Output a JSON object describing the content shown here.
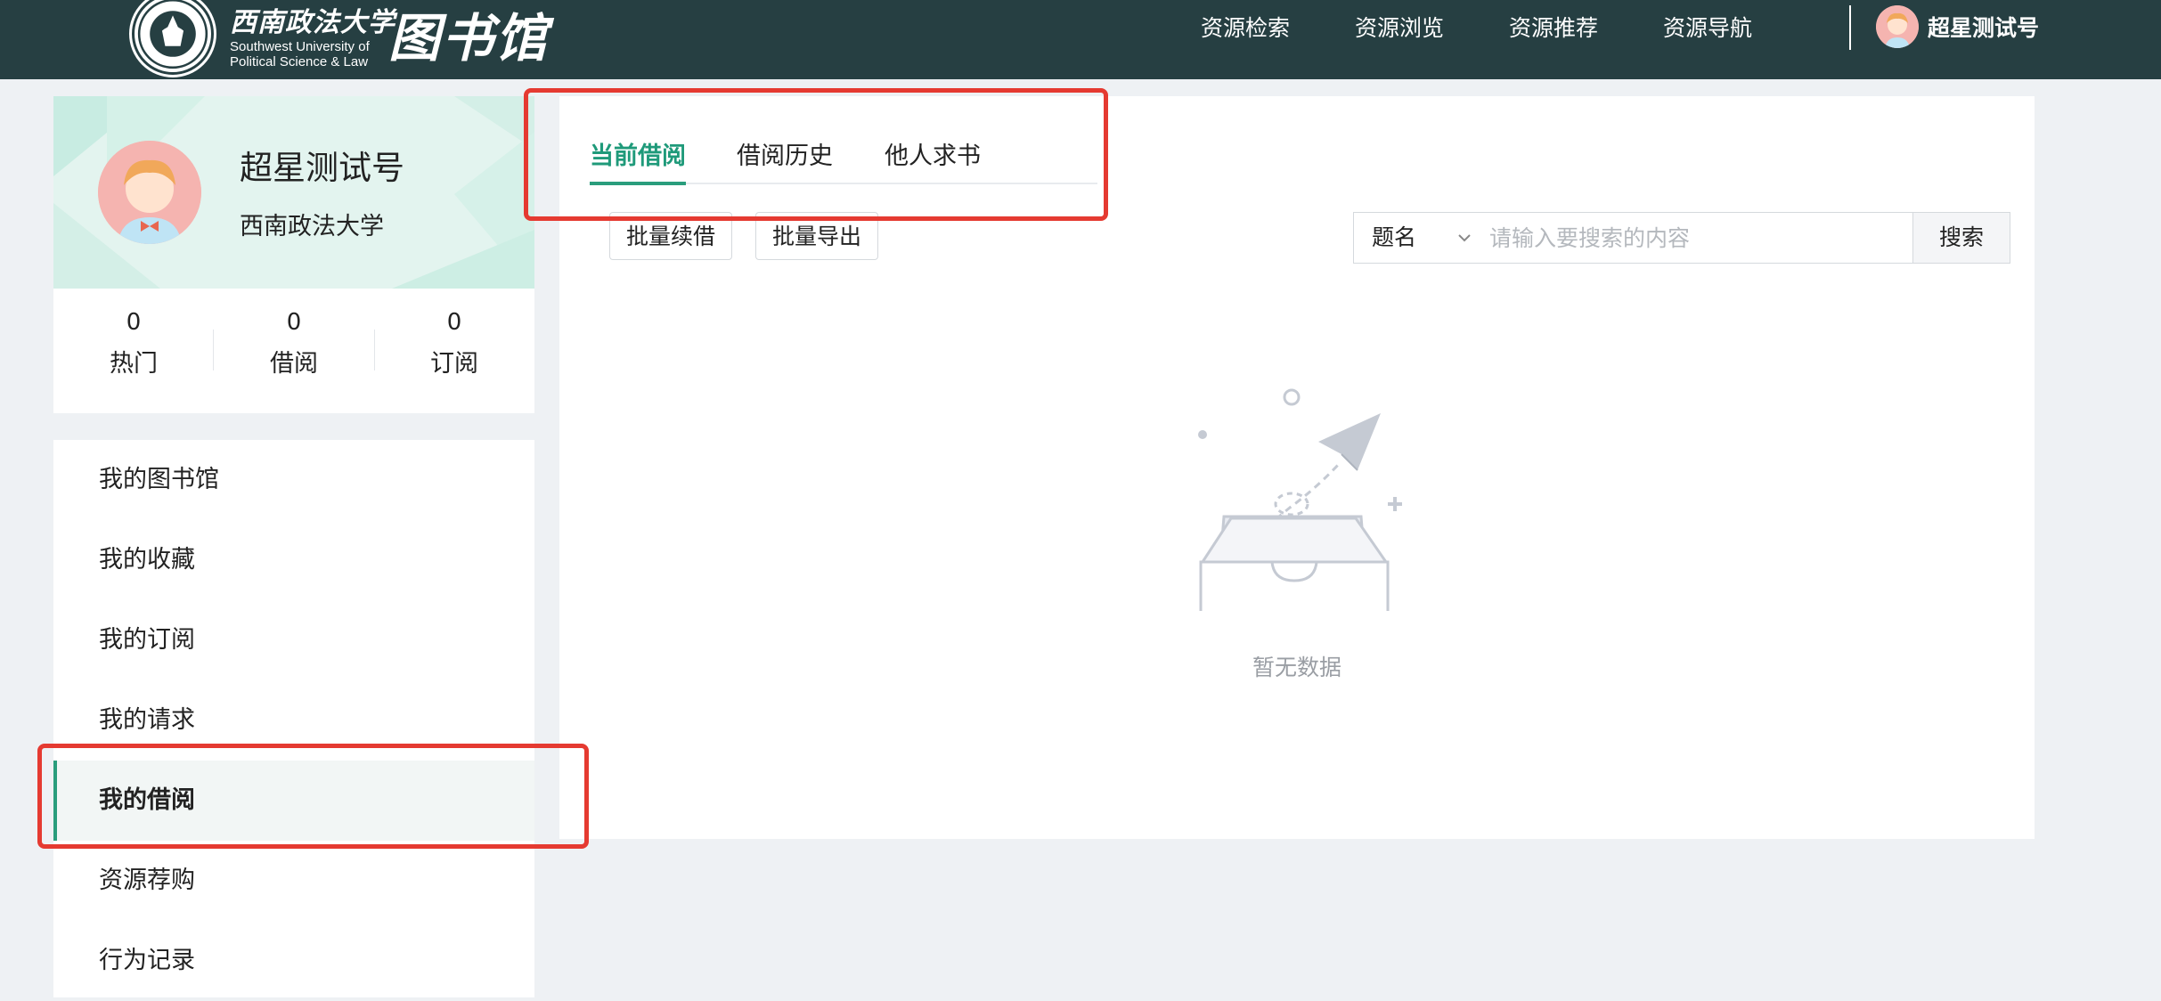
{
  "header": {
    "logo_cn": "西南政法大学",
    "logo_en_line1": "Southwest University of",
    "logo_en_line2": "Political Science & Law",
    "logo_library": "图书馆",
    "nav": [
      "资源检索",
      "资源浏览",
      "资源推荐",
      "资源导航"
    ],
    "user_name": "超星测试号"
  },
  "profile": {
    "name": "超星测试号",
    "school": "西南政法大学",
    "stats": [
      {
        "value": "0",
        "label": "热门"
      },
      {
        "value": "0",
        "label": "借阅"
      },
      {
        "value": "0",
        "label": "订阅"
      }
    ]
  },
  "menu": {
    "items": [
      "我的图书馆",
      "我的收藏",
      "我的订阅",
      "我的请求",
      "我的借阅",
      "资源荐购",
      "行为记录"
    ],
    "active": "我的借阅"
  },
  "main": {
    "tabs": [
      "当前借阅",
      "借阅历史",
      "他人求书"
    ],
    "active_tab": "当前借阅",
    "buttons": {
      "renew": "批量续借",
      "export": "批量导出"
    },
    "search": {
      "field": "题名",
      "placeholder": "请输入要搜索的内容",
      "button": "搜索"
    },
    "empty_text": "暂无数据"
  },
  "colors": {
    "header_bg": "#263f42",
    "accent": "#2a9d7c",
    "highlight": "#e53a31",
    "page_bg": "#eef1f4"
  }
}
